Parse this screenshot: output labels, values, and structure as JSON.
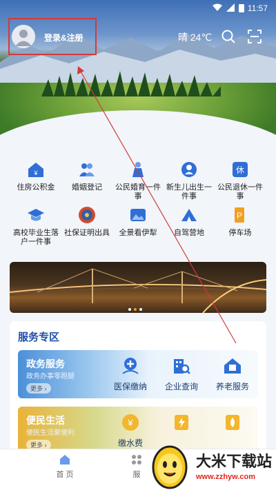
{
  "status_bar": {
    "time": "11:57"
  },
  "header": {
    "login_label": "登录&注册",
    "weather": "晴 24℃"
  },
  "services": [
    {
      "label": "住房公积金",
      "icon": "house-fund-icon"
    },
    {
      "label": "婚姻登记",
      "icon": "couple-icon"
    },
    {
      "label": "公民婚育一件事",
      "icon": "family-icon"
    },
    {
      "label": "新生儿出生一件事",
      "icon": "newborn-icon"
    },
    {
      "label": "公民退休一件事",
      "icon": "retire-icon"
    },
    {
      "label": "高校毕业生落户一件事",
      "icon": "graduate-icon"
    },
    {
      "label": "社保证明出具",
      "icon": "social-security-emblem-icon"
    },
    {
      "label": "全景看伊犁",
      "icon": "panorama-icon"
    },
    {
      "label": "自驾营地",
      "icon": "camp-icon"
    },
    {
      "label": "停车场",
      "icon": "parking-icon"
    }
  ],
  "banner": {
    "dots": 3,
    "active_dot": 1
  },
  "zone": {
    "title": "服务专区",
    "cards": [
      {
        "title": "政务服务",
        "subtitle": "政务办事零跑腿",
        "more": "更多 ›",
        "actions": [
          {
            "label": "医保缴纳",
            "icon": "medical-insurance-icon"
          },
          {
            "label": "企业查询",
            "icon": "enterprise-search-icon"
          },
          {
            "label": "养老服务",
            "icon": "elderly-service-icon"
          }
        ]
      },
      {
        "title": "便民生活",
        "subtitle": "便民生活聚便利",
        "more": "更多 ›",
        "actions": [
          {
            "label": "缴水费",
            "icon": "water-fee-icon"
          },
          {
            "label": "",
            "icon": "electric-fee-icon"
          },
          {
            "label": "",
            "icon": "gas-fee-icon"
          }
        ]
      }
    ]
  },
  "tabbar": [
    {
      "label": "首 页",
      "icon": "home-icon"
    },
    {
      "label": "服",
      "icon": "service-tab-icon"
    }
  ],
  "watermark": {
    "title": "大米下载站",
    "url": "www.zzhyw.com"
  },
  "colors": {
    "primary": "#1c4fa6",
    "annotation": "#d23a3a"
  }
}
